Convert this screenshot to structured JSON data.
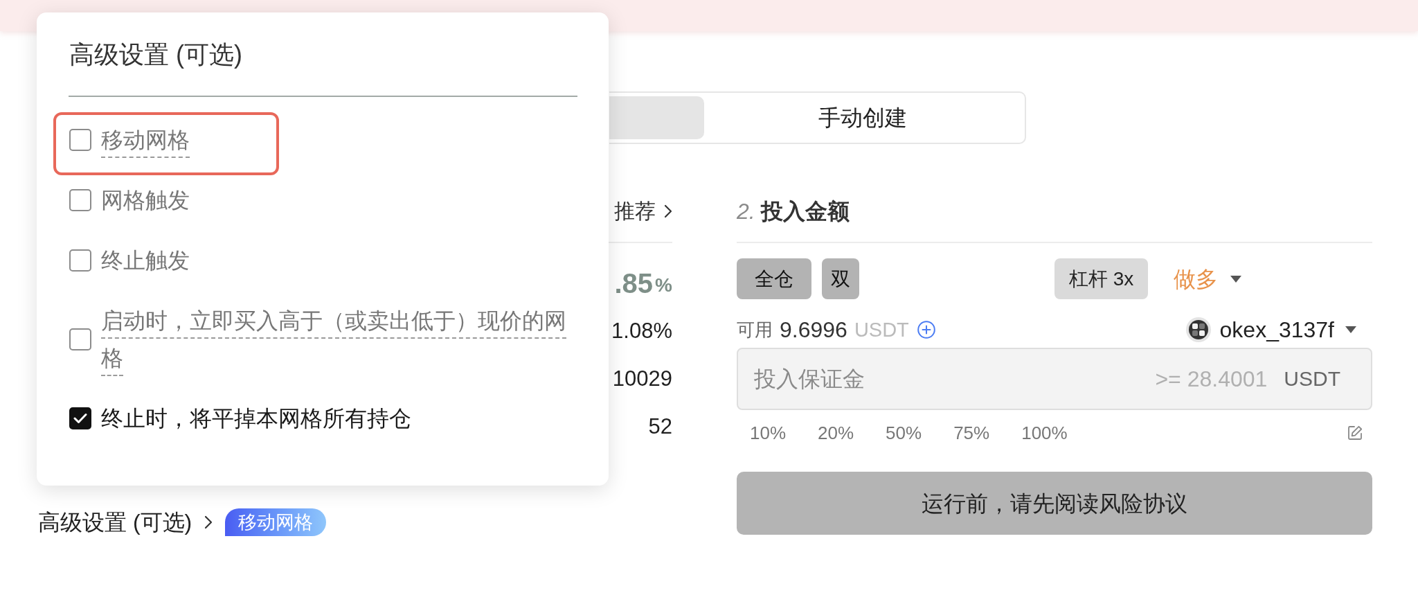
{
  "mode_tabs": [
    {
      "selected": true
    },
    {
      "label": "手动创建",
      "selected": false
    }
  ],
  "strategy": {
    "recommend_link": "推荐",
    "stats": [
      {
        "kind": "highlight",
        "value": ".85",
        "unit": "%"
      },
      {
        "kind": "plain",
        "value": "1.08%"
      },
      {
        "kind": "plain",
        "value": "10029"
      },
      {
        "kind": "plain",
        "value": "52"
      }
    ],
    "advanced_toggle": "高级设置 (可选)",
    "active_settings": [
      "移动网格"
    ]
  },
  "investment": {
    "step": "2.",
    "title": "投入金额",
    "margin_modes": [
      "全仓",
      "双"
    ],
    "leverage": "杠杆 3x",
    "direction": "做多",
    "available": {
      "label": "可用",
      "amount": "9.6996",
      "currency": "USDT"
    },
    "account": "okex_3137f",
    "margin_input": {
      "placeholder": "投入保证金",
      "minimum": ">= 28.4001",
      "unit": "USDT"
    },
    "percent_options": [
      "10%",
      "20%",
      "50%",
      "75%",
      "100%"
    ],
    "submit": {
      "label": "运行前，请先阅读风险协议",
      "disabled": true
    }
  },
  "advanced_popup": {
    "title": "高级设置 (可选)",
    "options": [
      {
        "label": "移动网格",
        "checked": false,
        "has_tooltip": true,
        "highlighted": true
      },
      {
        "label": "网格触发",
        "checked": false,
        "has_tooltip": false,
        "highlighted": false
      },
      {
        "label": "终止触发",
        "checked": false,
        "has_tooltip": false,
        "highlighted": false
      },
      {
        "label": "启动时，立即买入高于（或卖出低于）现价的网格",
        "checked": false,
        "has_tooltip": true,
        "highlighted": false
      },
      {
        "label": "终止时，将平掉本网格所有持仓",
        "checked": true,
        "has_tooltip": false,
        "highlighted": false
      }
    ]
  }
}
